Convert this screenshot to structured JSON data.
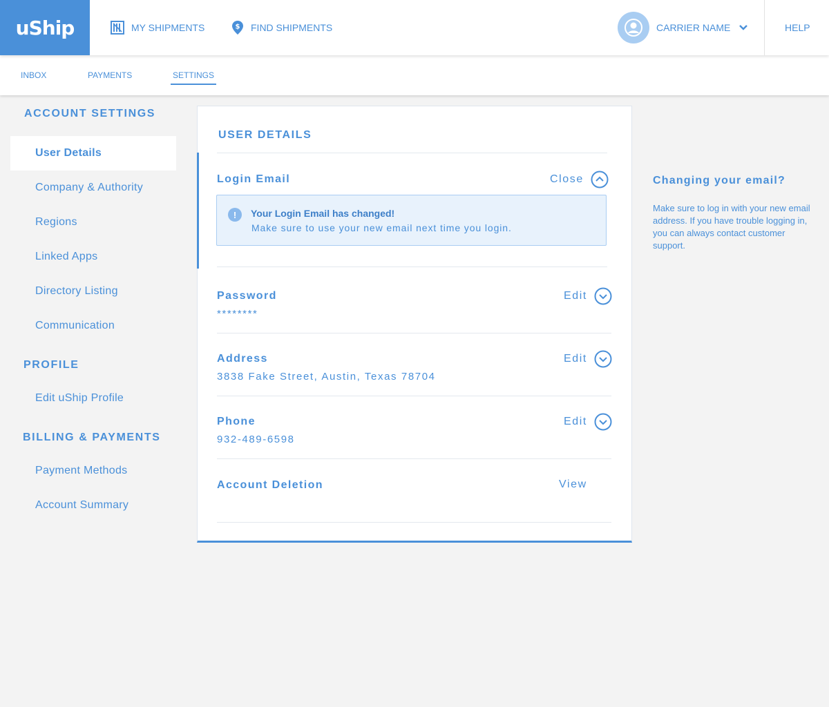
{
  "header": {
    "logo_text": "uShip",
    "nav": [
      {
        "label": "MY SHIPMENTS",
        "icon": "shipments-icon"
      },
      {
        "label": "FIND SHIPMENTS",
        "icon": "map-pin-dollar-icon"
      }
    ],
    "user_name": "CARRIER NAME",
    "help_label": "HELP"
  },
  "subnav": {
    "items": [
      "INBOX",
      "PAYMENTS",
      "SETTINGS"
    ],
    "active": "SETTINGS"
  },
  "sidebar": {
    "sections": [
      {
        "heading": "ACCOUNT SETTINGS",
        "items": [
          "User Details",
          "Company & Authority",
          "Regions",
          "Linked Apps",
          "Directory Listing",
          "Communication"
        ]
      },
      {
        "heading": "PROFILE",
        "items": [
          "Edit uShip Profile"
        ]
      },
      {
        "heading": "BILLING & PAYMENTS",
        "items": [
          "Payment Methods",
          "Account Summary"
        ]
      }
    ],
    "active_item": "User Details"
  },
  "card": {
    "title": "USER DETAILS",
    "login_email": {
      "label": "Login Email",
      "action": "Close",
      "alert_title": "Your Login Email has changed!",
      "alert_message": "Make sure to use your new email next time you login."
    },
    "password": {
      "label": "Password",
      "value": "********",
      "action": "Edit"
    },
    "address": {
      "label": "Address",
      "value": "3838 Fake Street, Austin, Texas 78704",
      "action": "Edit"
    },
    "phone": {
      "label": "Phone",
      "value": "932-489-6598",
      "action": "Edit"
    },
    "account_deletion": {
      "label": "Account Deletion",
      "action": "View"
    }
  },
  "help_panel": {
    "title": "Changing your email?",
    "body": "Make sure to log in with your new email address. If you have trouble logging in, you can always contact customer support."
  },
  "colors": {
    "accent": "#4a90d9",
    "background": "#f3f3f3",
    "alert_bg": "#e8f2fc"
  }
}
